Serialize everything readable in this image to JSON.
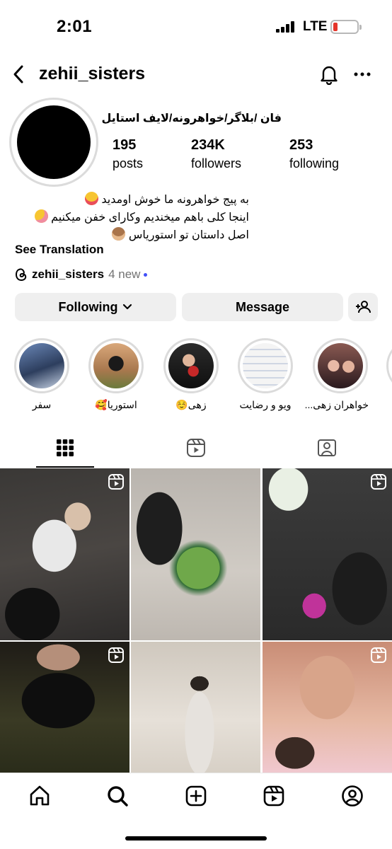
{
  "status_bar": {
    "time": "2:01",
    "network": "LTE",
    "battery_color": "#e5352a"
  },
  "header": {
    "username": "zehii_sisters",
    "back_icon": "chevron-left-icon",
    "bell_icon": "bell-icon",
    "more_icon": "more-horizontal-icon"
  },
  "profile": {
    "full_name": "فان /بلاگر/خواهرونه/لایف استایل",
    "stats": [
      {
        "value": "195",
        "label": "posts"
      },
      {
        "value": "234K",
        "label": "followers"
      },
      {
        "value": "253",
        "label": "following"
      }
    ],
    "bio_lines": [
      {
        "text": "به پیج خواهرونه ما خوش اومدید",
        "emoji": "heart-eyes-emoji"
      },
      {
        "text": "اینجا کلی باهم میخندیم وکارای خفن میکنیم",
        "emoji": "zany-face-emoji"
      },
      {
        "text": "اصل داستان تو استوریاس",
        "emoji": "see-no-evil-monkey-emoji"
      }
    ],
    "see_translation": "See Translation",
    "threads": {
      "handle": "zehii_sisters",
      "badge": "4 new"
    }
  },
  "actions": {
    "following_label": "Following",
    "message_label": "Message",
    "add_user_icon": "add-person-icon"
  },
  "highlights": [
    {
      "label": "سفر"
    },
    {
      "label": "استوریا🥰"
    },
    {
      "label": "زهی☺️"
    },
    {
      "label": "ویو و رضایت"
    },
    {
      "label": "خواهران زهی..."
    }
  ],
  "tabs": [
    {
      "name": "grid",
      "icon": "grid-icon",
      "active": true
    },
    {
      "name": "reels",
      "icon": "reels-icon",
      "active": false
    },
    {
      "name": "tagged",
      "icon": "tagged-icon",
      "active": false
    }
  ],
  "bottom_nav": [
    {
      "name": "home",
      "icon": "home-icon"
    },
    {
      "name": "search",
      "icon": "search-icon"
    },
    {
      "name": "create",
      "icon": "plus-square-icon"
    },
    {
      "name": "reels",
      "icon": "reels-icon"
    },
    {
      "name": "profile",
      "icon": "profile-icon"
    }
  ]
}
